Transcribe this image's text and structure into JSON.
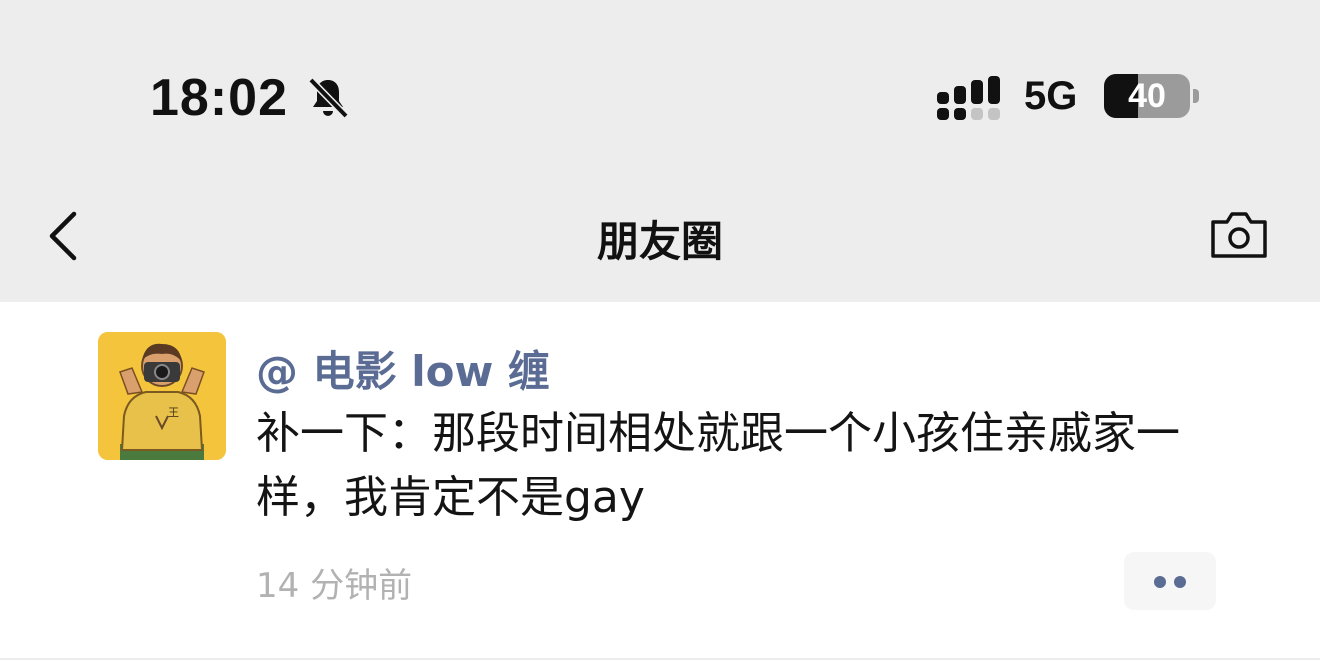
{
  "status_bar": {
    "time": "18:02",
    "network": "5G",
    "battery_percent": "40",
    "battery_level": 0.4,
    "icons": [
      "bell-muted-icon",
      "signal-icon",
      "battery-icon"
    ]
  },
  "nav": {
    "title": "朋友圈",
    "back_icon": "chevron-left-icon",
    "camera_icon": "camera-icon"
  },
  "post": {
    "author": "@ 电影 low 缠",
    "text": "补一下：那段时间相处就跟一个小孩住亲戚家一样，我肯定不是gay",
    "time_ago": "14 分钟前",
    "more_icon": "more-dots-icon"
  },
  "colors": {
    "header_bg": "#ededed",
    "author_link": "#5a6b94",
    "timestamp": "#b2b2b2",
    "avatar_bg": "#f4c53c"
  }
}
